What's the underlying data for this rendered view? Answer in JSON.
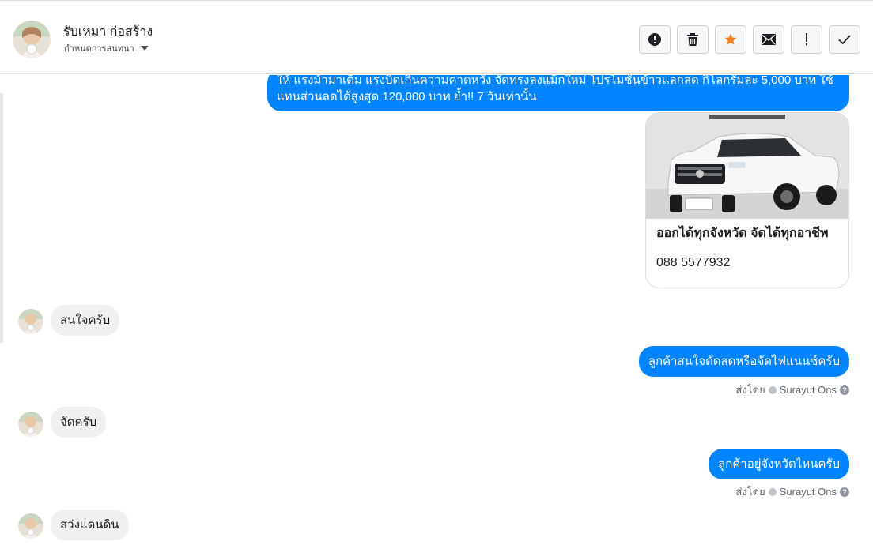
{
  "header": {
    "name": "รับเหมา ก่อสร้าง",
    "subtitle": "กำหนดการสนทนา",
    "actions": [
      {
        "icon": "alert-circle-icon",
        "name": "spam-button"
      },
      {
        "icon": "trash-icon",
        "name": "delete-button"
      },
      {
        "icon": "star-icon",
        "name": "star-button"
      },
      {
        "icon": "envelope-icon",
        "name": "mark-unread-button"
      },
      {
        "icon": "exclamation-icon",
        "name": "follow-up-button"
      },
      {
        "icon": "check-icon",
        "name": "done-button"
      }
    ]
  },
  "thread": {
    "long_message": "ให้ แรงม้ามาเต็ม แรงบิดเกินความคาดหวัง จัดทรงลงแม็กใหม่ โปรโมชั่นข้าวแลกลด กิโลกรัมละ 5,000 บาท ใช้แทนส่วนลดได้สูงสุด 120,000 บาท ย้ำ!! 7 วันเท่านั้น",
    "card": {
      "title": "ออกได้ทุกจังหวัด จัดได้ทุกอาชีพ",
      "phone": "088 5577932"
    },
    "messages": [
      {
        "dir": "in",
        "text": "สนใจครับ"
      },
      {
        "dir": "out",
        "text": "ลูกค้าสนใจตัดสดหรือจัดไฟแนนซ์ครับ",
        "sent_by_label": "ส่งโดย",
        "sender": "Surayut Ons"
      },
      {
        "dir": "in",
        "text": "จัดครับ"
      },
      {
        "dir": "out",
        "text": "ลูกค้าอยู่จังหวัดไหนครับ",
        "sent_by_label": "ส่งโดย",
        "sender": "Surayut Ons"
      },
      {
        "dir": "in",
        "text": "สว่งแดนดิน"
      }
    ]
  },
  "colors": {
    "outgoing": "#0084ff",
    "incoming": "#f1f0f0",
    "star": "#f5811f"
  }
}
